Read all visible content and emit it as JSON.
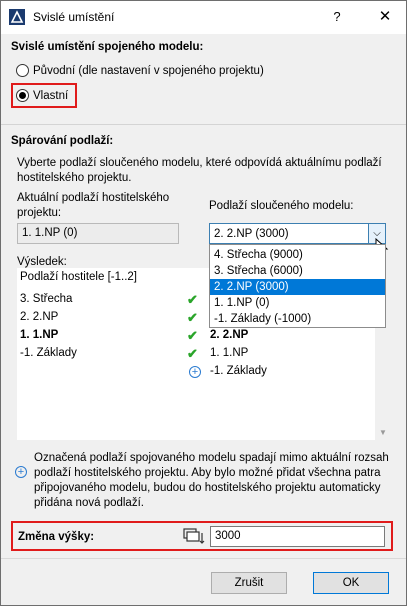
{
  "window": {
    "title": "Svislé umístění",
    "help": "?",
    "close": "✕"
  },
  "vertical": {
    "title": "Svislé umístění spojeného modelu:",
    "options": [
      "Původní (dle nastavení v spojeného projektu)",
      "Vlastní"
    ],
    "selected": "Vlastní"
  },
  "pairing": {
    "title": "Spárování podlaží:",
    "description": "Vyberte podlaží sloučeného modelu, které odpovídá aktuálnímu podlaží hostitelského projektu.",
    "host_label": "Aktuální podlaží hostitelského projektu:",
    "host_value": "1. 1.NP (0)",
    "merged_label": "Podlaží sloučeného modelu:",
    "merged_value": "2. 2.NP (3000)",
    "merged_options": [
      "4. Střecha (9000)",
      "3. Střecha (6000)",
      "2. 2.NP (3000)",
      "1. 1.NP (0)",
      "-1. Základy (-1000)"
    ],
    "merged_selected_index": 2
  },
  "result": {
    "label": "Výsledek:",
    "header": "Podlaží hostitele [-1..2]",
    "host_rows": [
      "3. Střecha",
      "2. 2.NP",
      "1. 1.NP",
      "-1. Základy"
    ],
    "host_bold_index": 2,
    "model_rows": [
      "2. 2.NP",
      "1. 1.NP",
      "-1. Základy"
    ]
  },
  "info": {
    "text": "Označená podlaží spojovaného modelu spadají mimo aktuální rozsah podlaží hostitelského projektu. Aby bylo možné přidat všechna patra připojovaného modelu, budou do hostitelského projektu automaticky přidána nová podlaží."
  },
  "height": {
    "label": "Změna výšky:",
    "value": "3000"
  },
  "buttons": {
    "cancel": "Zrušit",
    "ok": "OK"
  },
  "colors": {
    "highlight": "#e01b1b",
    "selection": "#0078d7",
    "check": "#2aa52a",
    "plus": "#2b7bd0"
  }
}
